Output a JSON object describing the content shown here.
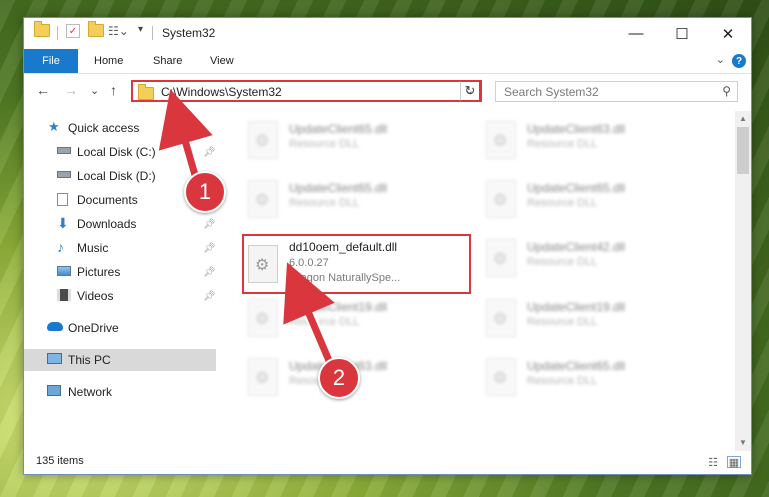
{
  "window": {
    "title": "System32",
    "controls": {
      "minimize": "—",
      "maximize": "☐",
      "close": "✕"
    }
  },
  "ribbon": {
    "tabs": [
      "File",
      "Home",
      "Share",
      "View"
    ],
    "help": "?",
    "collapse": "⌄"
  },
  "navigation": {
    "back": "←",
    "forward": "→",
    "recent": "⌄",
    "up": "↑",
    "address": "C:\\Windows\\System32",
    "refresh": "↻",
    "search_placeholder": "Search System32"
  },
  "sidebar": {
    "items": [
      {
        "label": "Quick access",
        "icon": "star-icon",
        "pinned": false
      },
      {
        "label": "Local Disk (C:)",
        "icon": "drive-icon",
        "pinned": true
      },
      {
        "label": "Local Disk (D:)",
        "icon": "drive-icon",
        "pinned": false
      },
      {
        "label": "Documents",
        "icon": "documents-icon",
        "pinned": true
      },
      {
        "label": "Downloads",
        "icon": "downloads-icon",
        "pinned": true
      },
      {
        "label": "Music",
        "icon": "music-icon",
        "pinned": true
      },
      {
        "label": "Pictures",
        "icon": "pictures-icon",
        "pinned": true
      },
      {
        "label": "Videos",
        "icon": "videos-icon",
        "pinned": true
      },
      {
        "label": "OneDrive",
        "icon": "cloud-icon",
        "pinned": false
      },
      {
        "label": "This PC",
        "icon": "computer-icon",
        "pinned": false,
        "selected": true
      },
      {
        "label": "Network",
        "icon": "network-icon",
        "pinned": false
      }
    ]
  },
  "files": [
    {
      "name": "UpdateClient65.dll",
      "line2": "Resource DLL",
      "blurred": true
    },
    {
      "name": "UpdateClient63.dll",
      "line2": "Resource DLL",
      "blurred": true
    },
    {
      "name": "UpdateClient65.dll",
      "line2": "Resource DLL",
      "blurred": true
    },
    {
      "name": "UpdateClient65.dll",
      "line2": "Resource DLL",
      "blurred": true
    },
    {
      "name": "dd10oem_default.dll",
      "line2": "6.0.0.27",
      "line3": "Dragon NaturallySpe...",
      "blurred": false
    },
    {
      "name": "UpdateClient42.dll",
      "line2": "Resource DLL",
      "blurred": true
    },
    {
      "name": "UpdateClient19.dll",
      "line2": "Resource DLL",
      "blurred": true
    },
    {
      "name": "UpdateClient19.dll",
      "line2": "Resource DLL",
      "blurred": true
    },
    {
      "name": "UpdateClient63.dll",
      "line2": "Resource DLL",
      "blurred": true
    },
    {
      "name": "UpdateClient65.dll",
      "line2": "Resource DLL",
      "blurred": true
    }
  ],
  "status": {
    "item_count": "135 items"
  },
  "callouts": {
    "one": "1",
    "two": "2"
  },
  "colors": {
    "accent": "#1979ca",
    "highlight": "#d9363e",
    "folder": "#f3cf5a"
  }
}
